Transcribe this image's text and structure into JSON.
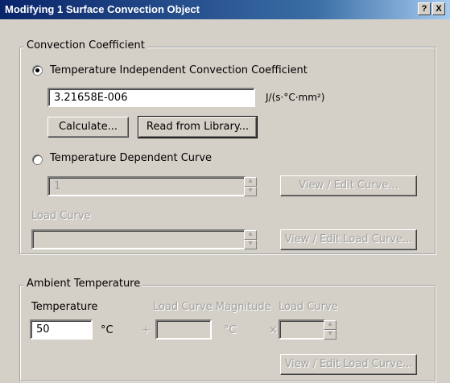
{
  "window": {
    "title": "Modifying 1 Surface Convection Object",
    "help_label": "?",
    "close_label": "X"
  },
  "convection": {
    "legend": "Convection Coefficient",
    "independent": {
      "label": "Temperature Independent Convection Coefficient",
      "selected": true,
      "value": "3.21658E-006",
      "unit": "J/(s·°C·mm²)",
      "calculate_label": "Calculate...",
      "library_label": "Read from Library..."
    },
    "dependent": {
      "label": "Temperature Dependent Curve",
      "selected": false,
      "curve_value": "1",
      "view_edit_curve_label": "View / Edit Curve..."
    },
    "load_curve": {
      "label": "Load Curve",
      "value": "",
      "view_edit_load_curve_label": "View / Edit Load Curve..."
    }
  },
  "ambient": {
    "legend": "Ambient Temperature",
    "temperature_label": "Temperature",
    "temperature_value": "50",
    "temperature_unit": "°C",
    "plus": "+",
    "magnitude_label": "Load Curve Magnitude",
    "magnitude_value": "",
    "magnitude_unit": "°C",
    "times": "×",
    "load_curve_label": "Load Curve",
    "load_curve_value": "",
    "view_edit_load_curve_label": "View / Edit Load Curve..."
  }
}
